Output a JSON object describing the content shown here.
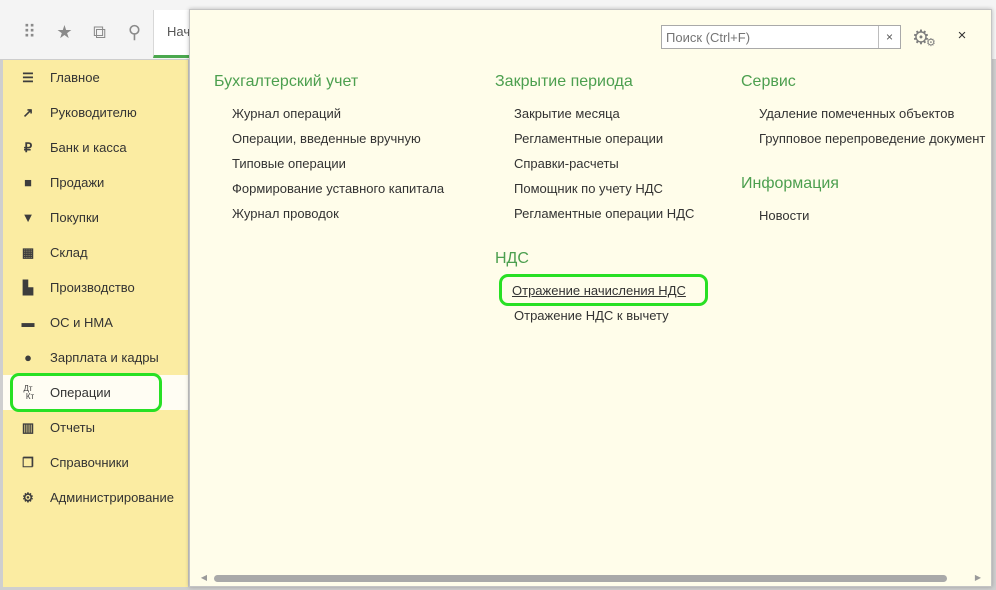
{
  "toolbar": {
    "icons": [
      "apps-grid-icon",
      "star-icon",
      "history-icon",
      "search-icon"
    ],
    "tab_label": "Нач"
  },
  "sidebar": {
    "items": [
      {
        "label": "Главное",
        "icon": "menu-lines-icon"
      },
      {
        "label": "Руководителю",
        "icon": "trend-icon"
      },
      {
        "label": "Банк и касса",
        "icon": "ruble-coin-icon"
      },
      {
        "label": "Продажи",
        "icon": "shopping-bag-icon"
      },
      {
        "label": "Покупки",
        "icon": "cart-icon"
      },
      {
        "label": "Склад",
        "icon": "warehouse-grid-icon"
      },
      {
        "label": "Производство",
        "icon": "factory-icon"
      },
      {
        "label": "ОС и НМА",
        "icon": "truck-icon"
      },
      {
        "label": "Зарплата и кадры",
        "icon": "person-icon"
      },
      {
        "label": "Операции",
        "icon": "dt-kt-icon",
        "icon_text_top": "Дт",
        "icon_text_bottom": "Кт"
      },
      {
        "label": "Отчеты",
        "icon": "bar-chart-icon"
      },
      {
        "label": "Справочники",
        "icon": "books-icon"
      },
      {
        "label": "Администрирование",
        "icon": "gear-icon"
      }
    ],
    "active": "Операции"
  },
  "panel": {
    "search_placeholder": "Поиск (Ctrl+F)",
    "clear_symbol": "×",
    "close_symbol": "×",
    "sections": {
      "accounting": {
        "title": "Бухгалтерский учет",
        "links": [
          "Журнал операций",
          "Операции, введенные вручную",
          "Типовые операции",
          "Формирование уставного капитала",
          "Журнал проводок"
        ]
      },
      "period_close": {
        "title": "Закрытие периода",
        "links": [
          "Закрытие месяца",
          "Регламентные операции",
          "Справки-расчеты",
          "Помощник по учету НДС",
          "Регламентные операции НДС"
        ]
      },
      "vat": {
        "title": "НДС",
        "links": [
          "Отражение начисления НДС",
          "Отражение НДС к вычету"
        ]
      },
      "service": {
        "title": "Сервис",
        "links": [
          "Удаление помеченных объектов",
          "Групповое перепроведение документ"
        ]
      },
      "info": {
        "title": "Информация",
        "links": [
          "Новости"
        ]
      }
    },
    "focused_link": "Отражение начисления НДС"
  },
  "colors": {
    "sidebar_bg": "#fbeca2",
    "panel_bg": "#fffdea",
    "section_title": "#4c9f4f",
    "highlight": "#28e024"
  }
}
